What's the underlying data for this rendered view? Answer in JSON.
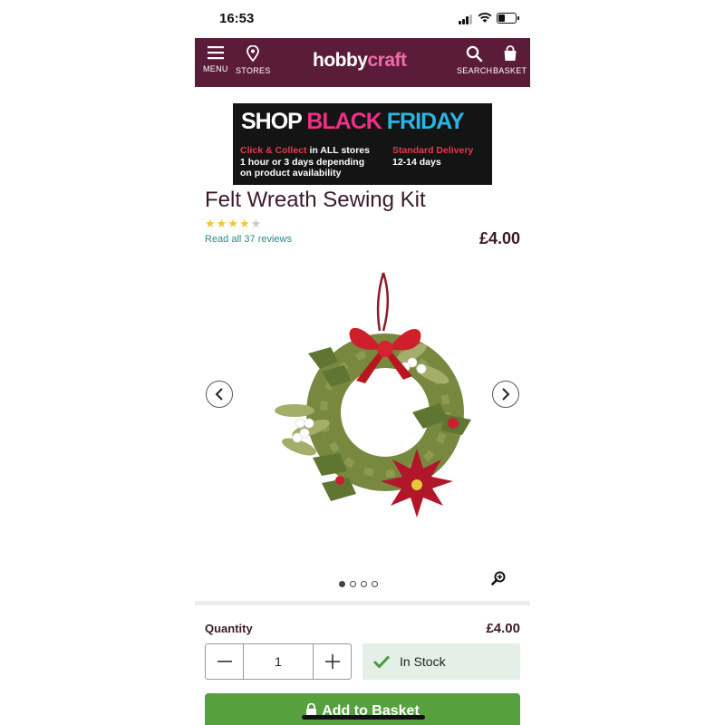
{
  "status_bar": {
    "time": "16:53"
  },
  "header": {
    "menu_label": "MENU",
    "stores_label": "STORES",
    "logo_part1": "hobby",
    "logo_part2": "craft",
    "search_label": "SEARCH",
    "basket_label": "BASKET",
    "background_color": "#5b1c39",
    "logo_accent_color": "#f06ca8"
  },
  "banner": {
    "shop": "SHOP ",
    "black": "BLACK ",
    "friday": "FRIDAY",
    "click_collect": "Click & Collect",
    "in_all_stores": " in ALL stores",
    "hour_line": "1 hour or 3 days depending",
    "availability_line": "on product availability",
    "standard_delivery": "Standard Delivery",
    "delivery_days": "12-14 days"
  },
  "product": {
    "title": "Felt Wreath Sewing Kit",
    "rating": 4,
    "rating_max": 5,
    "reviews_link": "Read all 37 reviews",
    "price": "£4.00",
    "image_subject": "felt christmas wreath with red bow, poinsettia and mistletoe",
    "gallery_count": 4,
    "gallery_active": 1
  },
  "purchase": {
    "quantity_label": "Quantity",
    "total_price": "£4.00",
    "quantity_value": "1",
    "stock_status": "In Stock",
    "add_to_basket": "Add to Basket",
    "button_color": "#56a03d"
  },
  "icons": [
    "menu-icon",
    "pin-icon",
    "search-icon",
    "basket-icon",
    "star-icon",
    "chevron-left-icon",
    "chevron-right-icon",
    "zoom-icon",
    "minus-icon",
    "plus-icon",
    "check-icon",
    "lock-icon"
  ]
}
